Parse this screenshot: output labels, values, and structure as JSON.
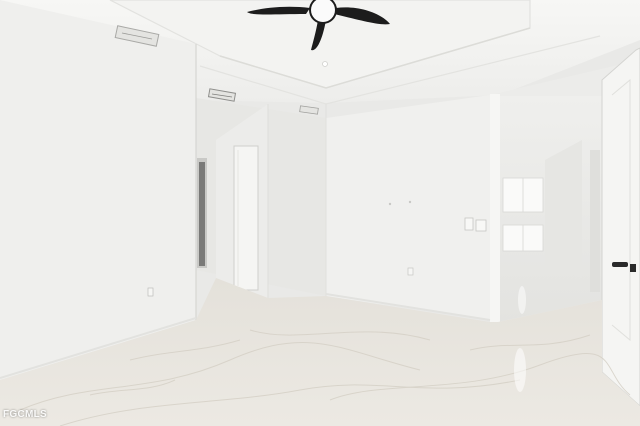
{
  "photo": {
    "description_tags": [
      "empty-room",
      "ceiling-fan",
      "marble-floor",
      "white-walls",
      "open-doorway",
      "closet-door"
    ],
    "colors": {
      "wall": "#f1f1ef",
      "wall_shadow": "#dcdcd9",
      "ceiling": "#f6f6f4",
      "floor": "#e7e3dc",
      "fan": "#1c1c1c",
      "door": "#f4f4f2"
    }
  },
  "watermark": {
    "text": "FGCMLS"
  }
}
